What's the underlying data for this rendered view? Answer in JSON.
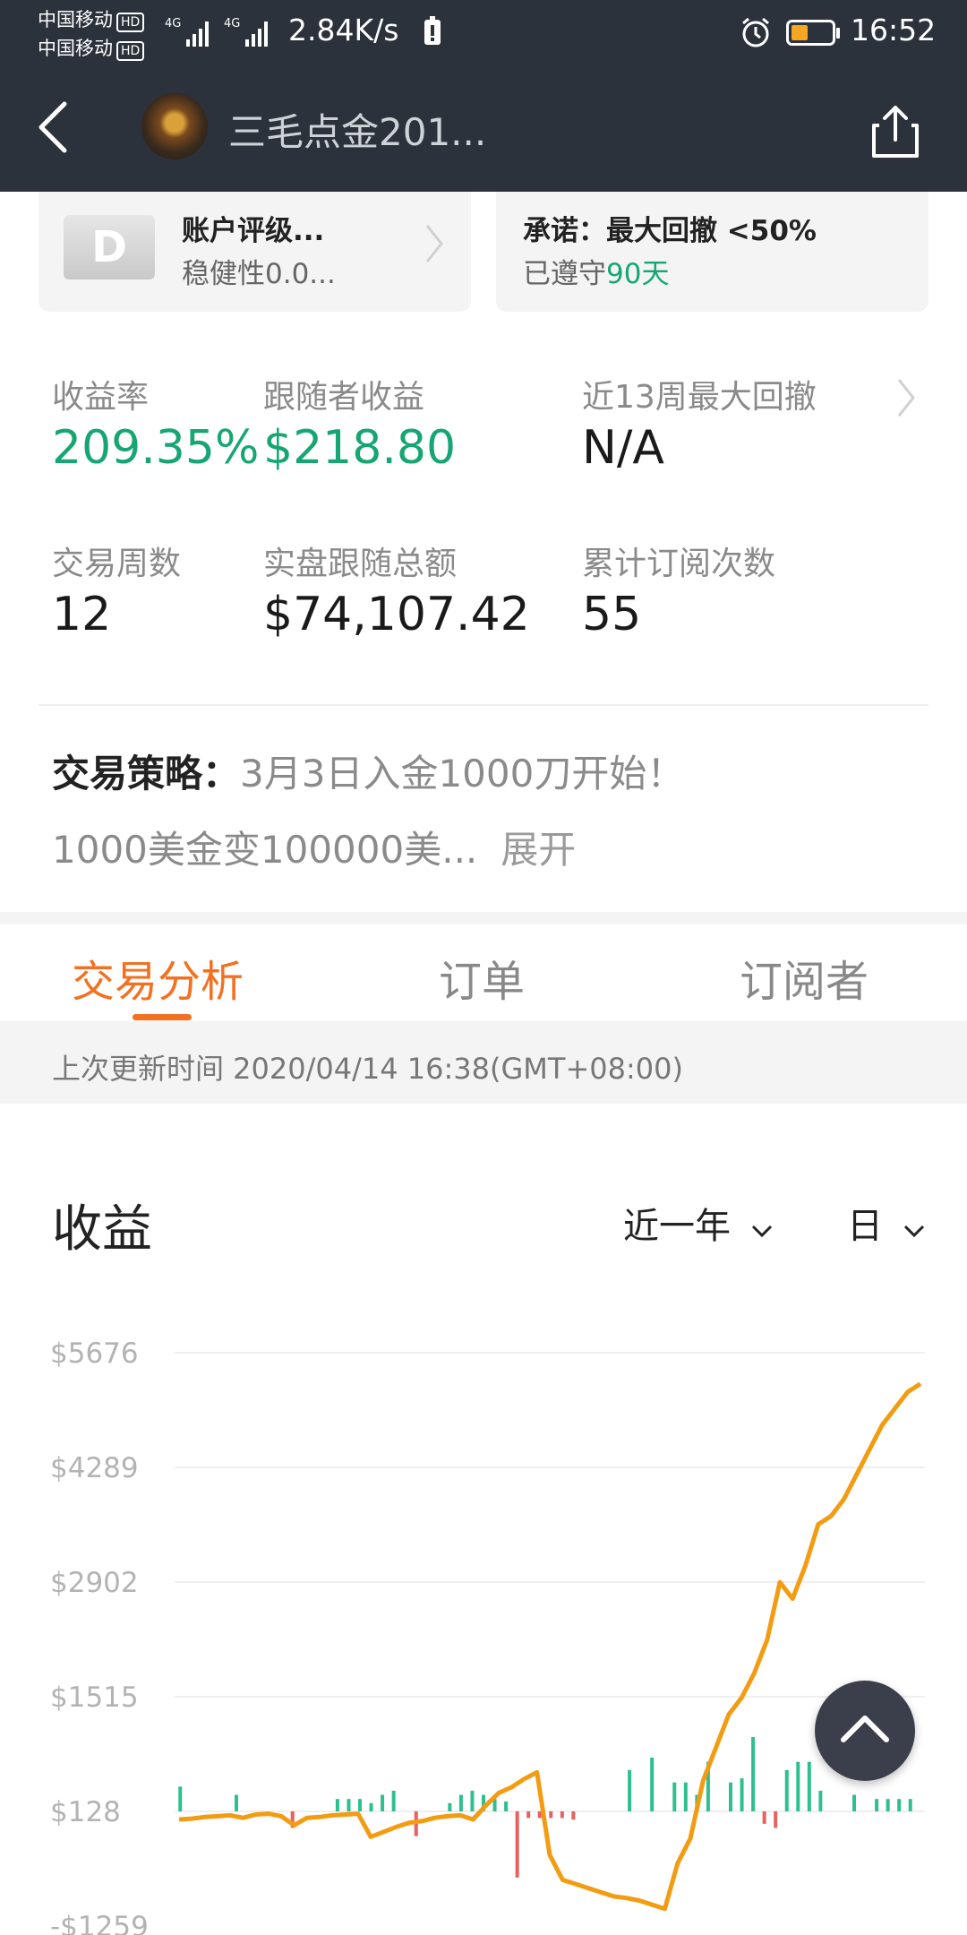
{
  "status_bar": {
    "carrier1": "中国移动",
    "carrier2": "中国移动",
    "hd": "HD",
    "net_type": "4G",
    "speed": "2.84K/s",
    "time": "16:52"
  },
  "header": {
    "title": "三毛点金201..."
  },
  "cards": {
    "rating": {
      "badge": "D",
      "title": "账户评级...",
      "subtitle": "稳健性0.0..."
    },
    "promise": {
      "title": "承诺：最大回撤 <50%",
      "kept_prefix": "已遵守",
      "kept_days": "90天"
    }
  },
  "stats": {
    "return_label": "收益率",
    "return_value": "209.35%",
    "follower_label": "跟随者收益",
    "follower_value": "$218.80",
    "drawdown_label": "近13周最大回撤",
    "drawdown_value": "N/A",
    "weeks_label": "交易周数",
    "weeks_value": "12",
    "total_label": "实盘跟随总额",
    "total_value": "$74,107.42",
    "subs_label": "累计订阅次数",
    "subs_value": "55"
  },
  "strategy": {
    "label": "交易策略：",
    "line1": "3月3日入金1000刀开始！",
    "line2": "1000美金变100000美...",
    "expand": "展开"
  },
  "tabs": [
    "交易分析",
    "订单",
    "订阅者"
  ],
  "update_text": "上次更新时间 2020/04/14 16:38(GMT+08:00)",
  "section": {
    "title": "收益",
    "range": "近一年",
    "period": "日"
  },
  "colors": {
    "bar_dark": "#2b323c",
    "accent_orange": "#f37021",
    "green": "#17a673",
    "line": "#f39c12",
    "bar_pos": "#2fbf8f",
    "bar_neg": "#e8605f"
  },
  "chart_data": {
    "type": "line",
    "ylabels": [
      "$5676",
      "$4289",
      "$2902",
      "$1515",
      "$128",
      "-$1259"
    ],
    "ylim": [
      -1259,
      5676
    ],
    "series": [
      {
        "values": [
          30,
          40,
          60,
          70,
          80,
          50,
          90,
          100,
          70,
          -40,
          50,
          60,
          80,
          90,
          100,
          -180,
          -120,
          -60,
          -10,
          10,
          50,
          70,
          80,
          30,
          200,
          350,
          420,
          520,
          600,
          -400,
          -700,
          -750,
          -800,
          -850,
          -900,
          -920,
          -950,
          -1000,
          -1050,
          -500,
          -200,
          500,
          900,
          1300,
          1500,
          1800,
          2200,
          2900,
          2700,
          3100,
          3600,
          3700,
          3900,
          4200,
          4500,
          4800,
          5000,
          5200,
          5300
        ]
      },
      {
        "values": [
          300,
          0,
          0,
          0,
          0,
          200,
          0,
          0,
          0,
          0,
          -200,
          0,
          0,
          0,
          150,
          150,
          150,
          100,
          200,
          250,
          0,
          -300,
          0,
          0,
          100,
          200,
          250,
          200,
          150,
          120,
          -800,
          -80,
          -80,
          -80,
          -80,
          -100,
          0,
          0,
          0,
          0,
          500,
          0,
          650,
          0,
          350,
          350,
          200,
          600,
          0,
          350,
          400,
          900,
          -150,
          -200,
          500,
          600,
          600,
          250,
          0,
          0,
          200,
          0,
          150,
          150,
          150,
          150
        ]
      }
    ]
  }
}
